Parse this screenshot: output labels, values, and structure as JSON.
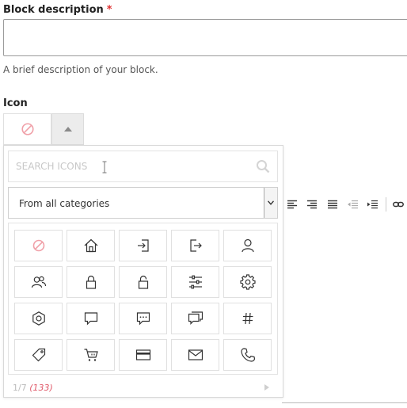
{
  "block_description": {
    "label": "Block description",
    "required_mark": "*",
    "value": "",
    "help_text": "A brief description of your block."
  },
  "icon_field": {
    "label": "Icon",
    "selected_icon": "none-icon"
  },
  "picker": {
    "search_placeholder": "SEARCH ICONS",
    "category_selected": "From all categories",
    "page_indicator": "1/7",
    "total_count": "(133)",
    "icons": [
      "none-icon",
      "home-icon",
      "login-icon",
      "logout-icon",
      "user-icon",
      "users-icon",
      "lock-icon",
      "unlock-icon",
      "sliders-icon",
      "gear-icon",
      "hexagon-cog-icon",
      "comment-icon",
      "comment-dots-icon",
      "comments-icon",
      "hashtag-icon",
      "tag-icon",
      "cart-icon",
      "credit-card-icon",
      "envelope-icon",
      "phone-icon"
    ]
  },
  "toolbar": {
    "buttons": [
      "align-center-icon",
      "align-right-icon",
      "align-justify-icon",
      "outdent-icon",
      "indent-icon",
      "link-icon"
    ]
  },
  "colors": {
    "required": "#e03030",
    "none_icon": "#f0a0a8",
    "count": "#e05a6a"
  }
}
